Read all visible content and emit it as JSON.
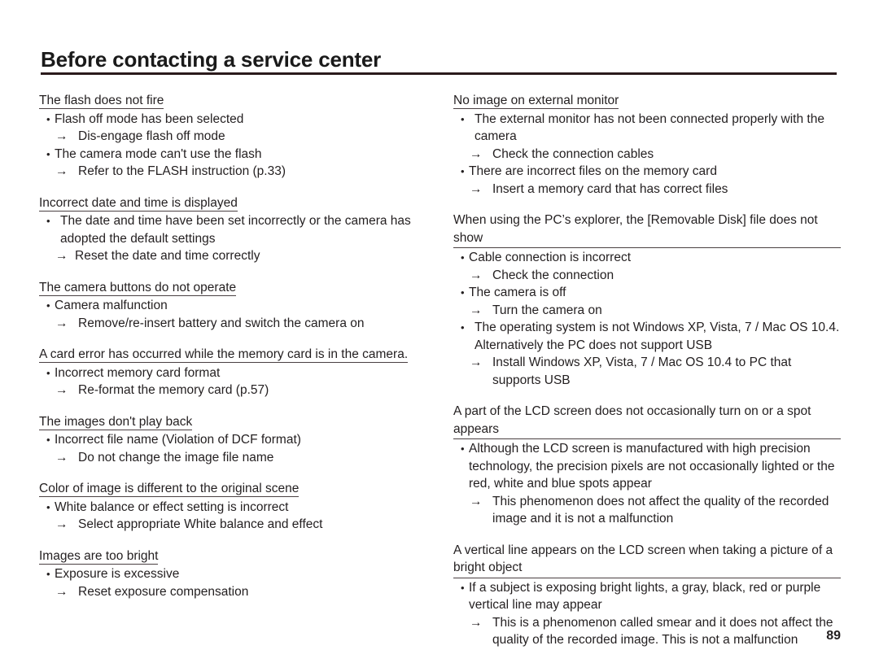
{
  "header": {
    "title": "Before contacting a service center"
  },
  "page_number": "89",
  "left_column": [
    {
      "heading": "The flash does not fire",
      "items": [
        {
          "type": "bullet",
          "spaced": false,
          "text": "Flash off mode has been selected"
        },
        {
          "type": "arrow",
          "tight": false,
          "text": "Dis-engage flash off mode"
        },
        {
          "type": "bullet",
          "spaced": false,
          "text": "The camera mode can't use the flash"
        },
        {
          "type": "arrow",
          "tight": false,
          "text": "Refer to the FLASH instruction (p.33)"
        }
      ]
    },
    {
      "heading": "Incorrect date and time is displayed",
      "items": [
        {
          "type": "bullet",
          "spaced": true,
          "text": "The date and time have been set incorrectly or the camera has adopted the default settings"
        },
        {
          "type": "arrow",
          "tight": true,
          "text": "Reset the date and time correctly"
        }
      ]
    },
    {
      "heading": "The camera buttons do not operate",
      "items": [
        {
          "type": "bullet",
          "spaced": false,
          "text": "Camera malfunction"
        },
        {
          "type": "arrow",
          "tight": false,
          "text": "Remove/re-insert battery and switch the camera on"
        }
      ]
    },
    {
      "heading": "A card error has occurred while the memory card is in the camera.",
      "items": [
        {
          "type": "bullet",
          "spaced": false,
          "text": "Incorrect memory card format"
        },
        {
          "type": "arrow",
          "tight": false,
          "text": "Re-format the memory card (p.57)"
        }
      ]
    },
    {
      "heading": "The images don't play back",
      "items": [
        {
          "type": "bullet",
          "spaced": false,
          "text": "Incorrect file name (Violation of DCF format)"
        },
        {
          "type": "arrow",
          "tight": false,
          "text": "Do not change the image file name"
        }
      ]
    },
    {
      "heading": "Color of image is different to the original scene",
      "items": [
        {
          "type": "bullet",
          "spaced": false,
          "text": "White balance or effect setting is incorrect"
        },
        {
          "type": "arrow",
          "tight": false,
          "text": "Select appropriate White balance and effect"
        }
      ]
    },
    {
      "heading": "Images are too bright",
      "items": [
        {
          "type": "bullet",
          "spaced": false,
          "text": "Exposure is excessive"
        },
        {
          "type": "arrow",
          "tight": false,
          "text": "Reset exposure compensation"
        }
      ]
    }
  ],
  "right_column": [
    {
      "heading": "No image on external monitor",
      "wide": false,
      "items": [
        {
          "type": "bullet",
          "spaced": true,
          "text": "The external monitor has not been connected properly with the camera"
        },
        {
          "type": "arrow",
          "tight": false,
          "text": "Check the connection cables"
        },
        {
          "type": "bullet",
          "spaced": false,
          "text": "There are incorrect files on the memory card"
        },
        {
          "type": "arrow",
          "tight": false,
          "text": "Insert a memory card that has correct files"
        }
      ]
    },
    {
      "heading": "When using the PC’s explorer, the [Removable Disk] file does not show",
      "wide": true,
      "items": [
        {
          "type": "bullet",
          "spaced": false,
          "text": "Cable connection is incorrect"
        },
        {
          "type": "arrow",
          "tight": false,
          "text": "Check the connection"
        },
        {
          "type": "bullet",
          "spaced": false,
          "text": "The camera is off"
        },
        {
          "type": "arrow",
          "tight": false,
          "text": "Turn the camera on"
        },
        {
          "type": "bullet",
          "spaced": true,
          "text": "The operating system is not Windows XP, Vista, 7 / Mac OS 10.4. Alternatively the PC does not support USB"
        },
        {
          "type": "arrow",
          "tight": false,
          "text": "Install Windows XP, Vista, 7 / Mac OS 10.4 to PC that supports USB"
        }
      ]
    },
    {
      "heading": "A part of the LCD screen does not occasionally turn on or a spot appears",
      "wide": true,
      "items": [
        {
          "type": "bullet",
          "spaced": false,
          "text": "Although the LCD screen is manufactured with high precision technology, the precision pixels are not occasionally lighted or the red, white and blue spots appear"
        },
        {
          "type": "arrow",
          "tight": false,
          "text": "This phenomenon does not affect the quality of the recorded image and it is not a malfunction"
        }
      ]
    },
    {
      "heading": "A vertical line appears on the LCD screen when taking a picture of a bright object",
      "wide": true,
      "items": [
        {
          "type": "bullet",
          "spaced": false,
          "text": "If a subject is exposing bright lights, a gray, black, red or purple vertical line may appear"
        },
        {
          "type": "arrow",
          "tight": false,
          "text": "This is a phenomenon called smear and it does not affect the quality of the recorded image. This is not a malfunction"
        }
      ]
    }
  ]
}
